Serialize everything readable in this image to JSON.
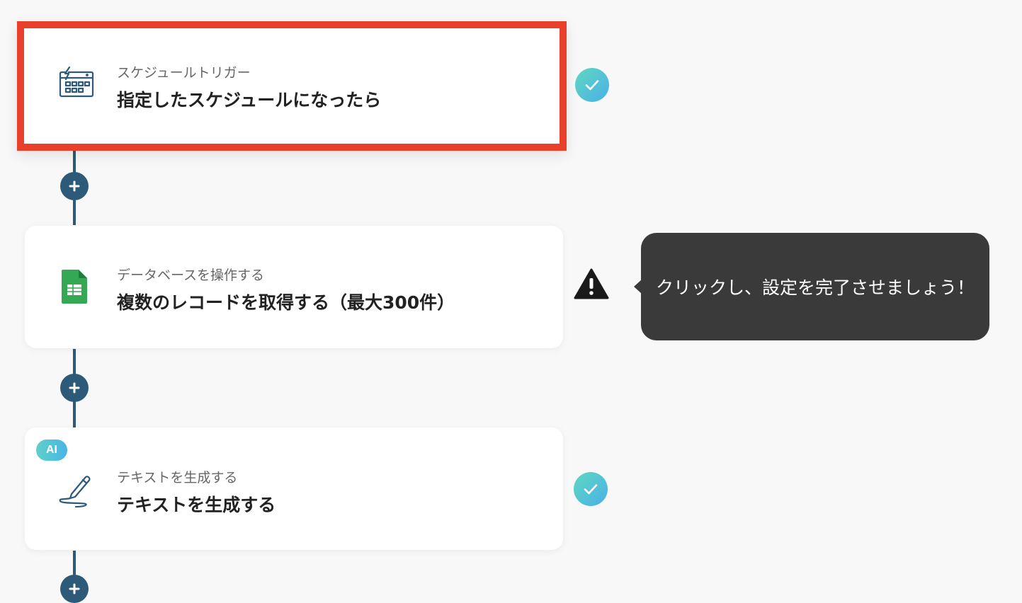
{
  "flow": {
    "steps": [
      {
        "subtitle": "スケジュールトリガー",
        "title": "指定したスケジュールになったら",
        "icon": "schedule-trigger-icon",
        "status": "complete"
      },
      {
        "subtitle": "データベースを操作する",
        "title": "複数のレコードを取得する（最大300件）",
        "icon": "google-sheets-icon",
        "status": "warning"
      },
      {
        "subtitle": "テキストを生成する",
        "title": "テキストを生成する",
        "icon": "pen-writing-icon",
        "status": "complete",
        "badge": "AI"
      }
    ],
    "tooltip": "クリックし、設定を完了させましょう！"
  },
  "colors": {
    "connector": "#2d5a78",
    "selected_border": "#e8402a",
    "tooltip_bg": "#3a3a3a",
    "success_gradient": [
      "#5fd8c0",
      "#4ab0e8"
    ],
    "sheets_green": "#1fa463"
  }
}
